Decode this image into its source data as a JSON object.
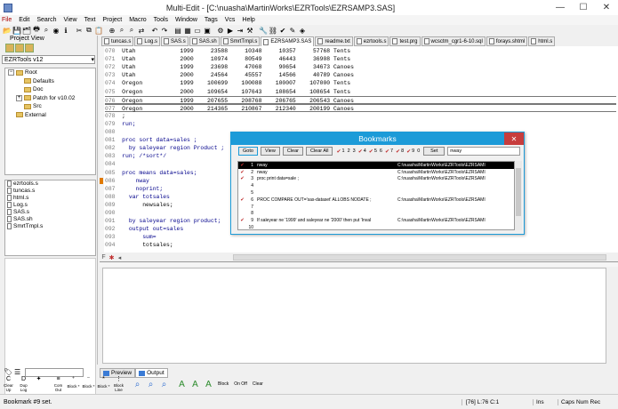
{
  "window": {
    "title": "Multi-Edit - [C:\\nuasha\\MartinWorks\\EZRTools\\EZRSAMP3.SAS]",
    "min": "—",
    "max": "☐",
    "close": "✕"
  },
  "menu": [
    "File",
    "Edit",
    "Search",
    "View",
    "Text",
    "Project",
    "Macro",
    "Tools",
    "Window",
    "Tags",
    "Vcs",
    "Help"
  ],
  "toolbar_icons": [
    "open-icon",
    "save-icon",
    "save-all-icon",
    "print-icon",
    "find-icon",
    "web-icon",
    "info-icon",
    "cut-icon",
    "copy-icon",
    "paste-icon",
    "zoom-icon",
    "find-next-icon",
    "find-prev-icon",
    "replace-icon",
    "undo-icon",
    "redo-icon",
    "tile-icon",
    "cascade-icon",
    "window-icon",
    "window2-icon",
    "compile-icon",
    "run-icon",
    "step-icon",
    "tools-icon",
    "wrench-icon",
    "link-icon",
    "bookmark-icon",
    "edit-icon",
    "macro-icon"
  ],
  "project": {
    "header": "Project View",
    "combo": "EZRTools v12",
    "tree": [
      {
        "label": "Root",
        "level": 0,
        "exp": "−"
      },
      {
        "label": "Defaults",
        "level": 1,
        "exp": ""
      },
      {
        "label": "Doc",
        "level": 1,
        "exp": ""
      },
      {
        "label": "Patch for v10.02",
        "level": 1,
        "exp": "+"
      },
      {
        "label": "Src",
        "level": 1,
        "exp": ""
      },
      {
        "label": "External",
        "level": 0,
        "exp": ""
      }
    ],
    "files": [
      "ezrtools.s",
      "tuncas.s",
      "html.s",
      "Log.s",
      "SAS.s",
      "SAS.sh",
      "SmrtTmpl.s"
    ]
  },
  "tabs": [
    "tuncas.s",
    "Log.s",
    "SAS.s",
    "SAS.sh",
    "SmrtTmpl.s",
    "EZRSAMP3.SAS",
    "readme.txt",
    "ezrtools.s",
    "test.prg",
    "wcsctm_cgr1-6-10.sql",
    "forays.shtml",
    "html.s"
  ],
  "active_tab": "EZRSAMP3.SAS",
  "code_lines": [
    {
      "n": "070",
      "t": "  Utah             1999     23588     10348     10357     57768 Tents"
    },
    {
      "n": "071",
      "t": "  Utah             2000     10974     80549     46443     36908 Tents"
    },
    {
      "n": "072",
      "t": "  Utah             1999     23698     47068     90654     34673 Canoes"
    },
    {
      "n": "073",
      "t": "  Utah             2000     24564     45557     14566     40789 Canoes"
    },
    {
      "n": "074",
      "t": "  Oregon           1999    100699    100088    100007    107000 Tents"
    },
    {
      "n": "075",
      "t": "  Oregon           2000    109654    107643    108654    108654 Tents"
    },
    {
      "n": "076",
      "t": "  Oregon           1999    207655    208768    206765    206543 Canoes"
    },
    {
      "n": "077",
      "t": "  Oregon           2000    214365    210867    212340    200199 Canoes"
    },
    {
      "n": "078",
      "t": "  ;"
    },
    {
      "n": "079",
      "t": "  run;"
    },
    {
      "n": "080",
      "t": ""
    },
    {
      "n": "081",
      "t": "  proc sort data=sales ;"
    },
    {
      "n": "082",
      "t": "    by saleyear region Product ;"
    },
    {
      "n": "083",
      "t": "  run; /*sort*/"
    },
    {
      "n": "084",
      "t": ""
    },
    {
      "n": "085",
      "t": "  proc means data=sales;"
    },
    {
      "n": "086",
      "t": "      nway"
    },
    {
      "n": "087",
      "t": "      noprint;"
    },
    {
      "n": "088",
      "t": "    var totsales"
    },
    {
      "n": "089",
      "t": "        newsales;"
    },
    {
      "n": "090",
      "t": ""
    },
    {
      "n": "091",
      "t": "    by saleyear region product;"
    },
    {
      "n": "092",
      "t": "    output out=sales"
    },
    {
      "n": "093",
      "t": "        sum="
    },
    {
      "n": "094",
      "t": "        totsales;"
    }
  ],
  "bookmarks": {
    "title": "Bookmarks",
    "buttons": {
      "goto": "Goto",
      "view": "View",
      "clear": "Clear",
      "clear_all": "Clear All",
      "set": "Set"
    },
    "numbers": [
      "1",
      "2",
      "3",
      "4",
      "5",
      "6",
      "7",
      "8",
      "9",
      "0"
    ],
    "checked_numbers": [
      "1",
      "4",
      "5",
      "7",
      "8",
      "9"
    ],
    "search": "nway",
    "rows": [
      {
        "num": "1",
        "text": "nway",
        "path": "C:\\nuasha\\MartinWorks\\EZRTools\\EZRSAMI",
        "checked": true,
        "selected": true
      },
      {
        "num": "2",
        "text": "nway",
        "path": "C:\\nuasha\\MartinWorks\\EZRTools\\EZRSAMI",
        "checked": true,
        "selected": false
      },
      {
        "num": "3",
        "text": "proc print data=sale ;",
        "path": "C:\\nuasha\\MartinWorks\\EZRTools\\EZRSAMI",
        "checked": true,
        "selected": false
      },
      {
        "num": "4",
        "text": "",
        "path": "",
        "checked": false,
        "selected": false
      },
      {
        "num": "5",
        "text": "",
        "path": "",
        "checked": false,
        "selected": false
      },
      {
        "num": "6",
        "text": "PROC COMPARE OUT='sas-dataset' ALLOBS NODATE ;",
        "path": "C:\\nuasha\\MartinWorks\\EZRTools\\EZRSAMI",
        "checked": true,
        "selected": false
      },
      {
        "num": "7",
        "text": "",
        "path": "",
        "checked": false,
        "selected": false
      },
      {
        "num": "8",
        "text": "",
        "path": "",
        "checked": false,
        "selected": false
      },
      {
        "num": "9",
        "text": "If saleyear ne '1999' and saleyear ne '2000' then put 'Inval",
        "path": "C:\\nuasha\\MartinWorks\\EZRTools\\EZRSAMI",
        "checked": true,
        "selected": false
      },
      {
        "num": "10",
        "text": "",
        "path": "",
        "checked": false,
        "selected": false
      }
    ]
  },
  "output_tabs": [
    "Preview",
    "Output"
  ],
  "output_active": "Output",
  "bottom_buttons": [
    {
      "icon": "C",
      "label": "Clear Up"
    },
    {
      "icon": "D",
      "label": "Dup Log"
    },
    {
      "icon": "✦",
      "label": ""
    },
    {
      "icon": "≡",
      "label": "Com Out"
    },
    {
      "icon": "⁺",
      "label": "Block *"
    },
    {
      "icon": "⁻",
      "label": "Block *"
    },
    {
      "icon": "*",
      "label": "Block *"
    },
    {
      "icon": "⋮",
      "label": "Block Line"
    }
  ],
  "bottom_text": [
    "Block",
    "On Off",
    "Clear"
  ],
  "status": {
    "message": "Bookmark #9 set.",
    "position": "[76] L:76 C:1",
    "insert": "Ins",
    "locks": "Caps Num Rec"
  }
}
